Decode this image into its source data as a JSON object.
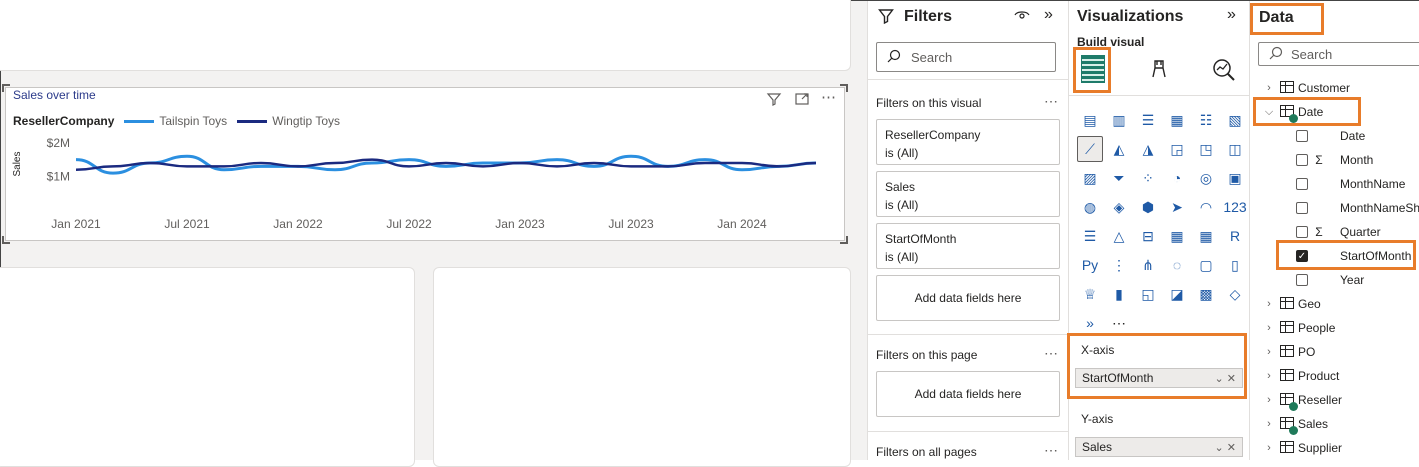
{
  "canvas": {
    "chart": {
      "title": "Sales over time",
      "legend_title": "ResellerCompany",
      "ylabel": "Sales"
    }
  },
  "chart_data": {
    "type": "line",
    "title": "Sales over time",
    "xlabel": "",
    "ylabel": "Sales",
    "x_ticks": [
      "Jan 2021",
      "Jul 2021",
      "Jan 2022",
      "Jul 2022",
      "Jan 2023",
      "Jul 2023",
      "Jan 2024"
    ],
    "y_ticks": [
      "$1M",
      "$2M"
    ],
    "x": [
      "2021-01",
      "2021-03",
      "2021-05",
      "2021-07",
      "2021-09",
      "2021-11",
      "2022-01",
      "2022-03",
      "2022-05",
      "2022-07",
      "2022-09",
      "2022-11",
      "2023-01",
      "2023-03",
      "2023-05",
      "2023-07",
      "2023-09",
      "2023-11",
      "2024-01",
      "2024-03",
      "2024-05"
    ],
    "ylim": [
      0.6,
      2.2
    ],
    "series": [
      {
        "name": "Tailspin Toys",
        "color": "#2b8fe0",
        "values": [
          1.5,
          1.1,
          1.4,
          1.6,
          1.2,
          1.3,
          1.3,
          1.2,
          1.4,
          1.5,
          1.3,
          1.4,
          1.4,
          1.5,
          1.3,
          1.6,
          1.3,
          1.5,
          1.2,
          1.3,
          1.4
        ]
      },
      {
        "name": "Wingtip Toys",
        "color": "#1b2a80",
        "values": [
          1.2,
          1.3,
          1.4,
          1.3,
          1.3,
          1.4,
          1.3,
          1.4,
          1.5,
          1.3,
          1.4,
          1.3,
          1.4,
          1.3,
          1.4,
          1.3,
          1.3,
          1.4,
          1.4,
          1.3,
          1.4
        ]
      }
    ]
  },
  "filters": {
    "title": "Filters",
    "search_placeholder": "Search",
    "on_visual_label": "Filters on this visual",
    "cards": [
      {
        "field": "ResellerCompany",
        "value": "is (All)"
      },
      {
        "field": "Sales",
        "value": "is (All)"
      },
      {
        "field": "StartOfMonth",
        "value": "is (All)"
      }
    ],
    "add_fields": "Add data fields here",
    "on_page_label": "Filters on this page",
    "on_all_label": "Filters on all pages"
  },
  "viz": {
    "title": "Visualizations",
    "build_visual": "Build visual",
    "xaxis_label": "X-axis",
    "xaxis_field": "StartOfMonth",
    "yaxis_label": "Y-axis",
    "yaxis_field": "Sales",
    "icons": [
      "stacked-bar",
      "clustered-column",
      "clustered-bar",
      "stacked-column",
      "100-bar",
      "100-column",
      "line",
      "area",
      "stacked-area",
      "line-column",
      "line-clustered",
      "ribbon",
      "waterfall",
      "funnel",
      "scatter",
      "pie",
      "donut",
      "treemap",
      "map",
      "filled-map",
      "shape-map",
      "azure-map",
      "gauge",
      "card",
      "multi-row-card",
      "kpi",
      "slicer",
      "table",
      "matrix",
      "r-visual",
      "python-visual",
      "key-influencers",
      "decomposition-tree",
      "qa",
      "smart-narrative",
      "paginated",
      "trophy",
      "report",
      "power-apps",
      "power-automate",
      "metrics",
      "custom",
      "arrow",
      "more"
    ]
  },
  "data": {
    "title": "Data",
    "search_placeholder": "Search",
    "tables": [
      {
        "name": "Customer",
        "expanded": false
      },
      {
        "name": "Date",
        "expanded": true,
        "fields": [
          {
            "name": "Date",
            "sigma": false,
            "checked": false
          },
          {
            "name": "Month",
            "sigma": true,
            "checked": false
          },
          {
            "name": "MonthName",
            "sigma": false,
            "checked": false
          },
          {
            "name": "MonthNameSh...",
            "sigma": false,
            "checked": false
          },
          {
            "name": "Quarter",
            "sigma": true,
            "checked": false
          },
          {
            "name": "StartOfMonth",
            "sigma": false,
            "checked": true
          },
          {
            "name": "Year",
            "sigma": false,
            "checked": false
          }
        ]
      },
      {
        "name": "Geo",
        "expanded": false
      },
      {
        "name": "People",
        "expanded": false
      },
      {
        "name": "PO",
        "expanded": false
      },
      {
        "name": "Product",
        "expanded": false
      },
      {
        "name": "Reseller",
        "expanded": false
      },
      {
        "name": "Sales",
        "expanded": false
      },
      {
        "name": "Supplier",
        "expanded": false
      }
    ]
  }
}
